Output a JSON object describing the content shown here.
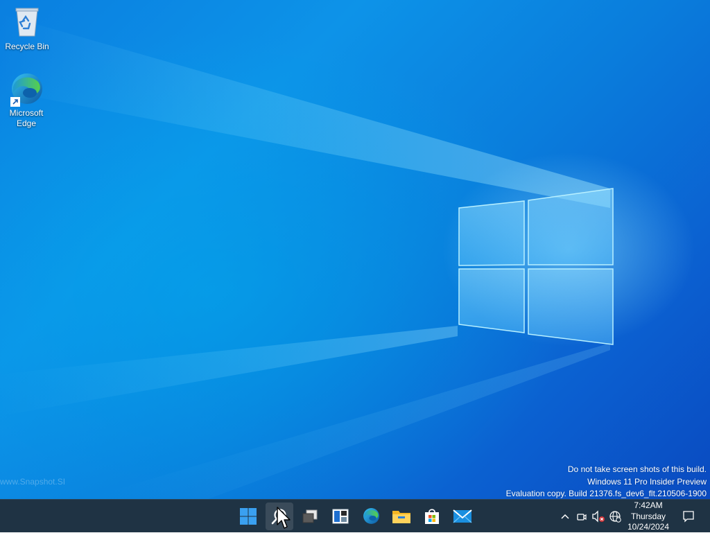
{
  "desktop": {
    "icons": [
      {
        "label": "Recycle Bin",
        "icon": "recycle-bin-icon"
      },
      {
        "label": "Microsoft\nEdge",
        "icon": "edge-icon"
      }
    ],
    "faint_text": "www.Snapshot.SI",
    "watermark": {
      "line1": "Do not take screen shots of this build.",
      "line2": "Windows 11 Pro Insider Preview",
      "line3": "Evaluation copy. Build 21376.fs_dev6_flt.210506-1900"
    }
  },
  "taskbar": {
    "apps": [
      {
        "name": "start",
        "icon": "windows-start-icon"
      },
      {
        "name": "search",
        "icon": "search-icon"
      },
      {
        "name": "task-view",
        "icon": "task-view-icon"
      },
      {
        "name": "widgets",
        "icon": "widgets-icon"
      },
      {
        "name": "edge",
        "icon": "edge-icon"
      },
      {
        "name": "file-explorer",
        "icon": "folder-icon"
      },
      {
        "name": "store",
        "icon": "store-icon"
      },
      {
        "name": "mail",
        "icon": "mail-icon"
      }
    ],
    "tray": {
      "icons": [
        "chevron-up-icon",
        "meet-now-icon",
        "volume-muted-icon",
        "network-globe-icon"
      ],
      "time": "7:42AM",
      "day": "Thursday",
      "date": "10/24/2024",
      "notification_icon": "notification-icon"
    }
  },
  "colors": {
    "taskbar_bg": "#1f3344",
    "wallpaper_blue": "#0a7fe0",
    "accent": "#0078d4"
  }
}
